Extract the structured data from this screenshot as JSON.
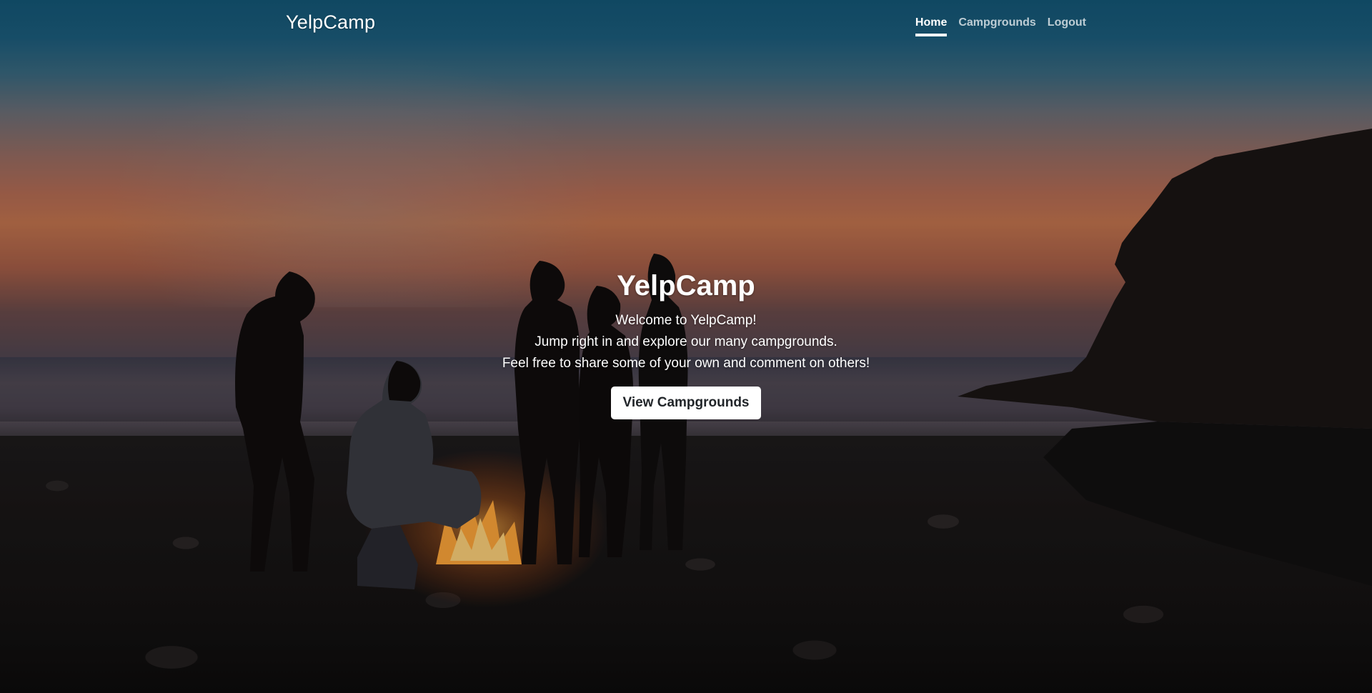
{
  "navbar": {
    "brand": "YelpCamp",
    "links": [
      {
        "label": "Home",
        "active": true
      },
      {
        "label": "Campgrounds",
        "active": false
      },
      {
        "label": "Logout",
        "active": false
      }
    ]
  },
  "hero": {
    "title": "YelpCamp",
    "lines": [
      "Welcome to YelpCamp!",
      "Jump right in and explore our many campgrounds.",
      "Feel free to share some of your own and comment on others!"
    ],
    "button_label": "View Campgrounds"
  },
  "background": {
    "description_icon": "campfire-beach-sunset-photo"
  },
  "colors": {
    "nav_active": "#ffffff",
    "nav_inactive": "rgba(255,255,255,0.72)",
    "button_bg": "#ffffff",
    "button_text": "#212529"
  }
}
